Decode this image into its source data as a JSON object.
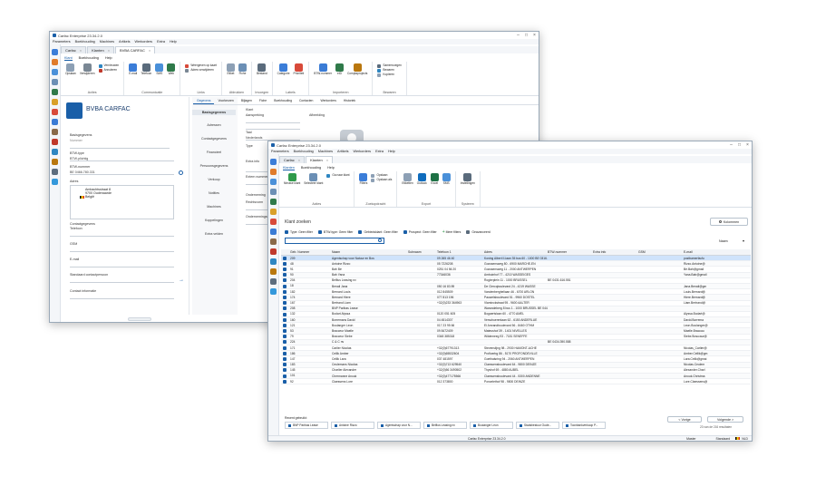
{
  "back": {
    "title": "Carfac Enterprise 23.34.2.0",
    "menu": [
      "Parameters",
      "Boekhouding",
      "Machines",
      "Artikels",
      "Werkorders",
      "Extra",
      "Help"
    ],
    "tabs": [
      {
        "label": "Carfac"
      },
      {
        "label": "Klanten"
      },
      {
        "label": "BVBA CARFAC"
      }
    ],
    "ribbon_tabs": [
      "Klant",
      "Boekhouding",
      "Help"
    ],
    "groups": {
      "acties": {
        "label": "Acties",
        "buttons": [
          "Opslaan",
          "Verwijderen"
        ],
        "small": [
          "Vernieuwen",
          "Annuleren"
        ]
      },
      "communicatie": {
        "label": "Communicatie",
        "buttons": [
          "E-mail",
          "Telefoon",
          "SMS",
          "Web"
        ]
      },
      "links": {
        "label": "Links",
        "small": [
          "Weergeven op kaart",
          "Adres verwijderen"
        ]
      },
      "afdrukken": {
        "label": "Afdrukken",
        "buttons": [
          "Etiket",
          "Fiche"
        ]
      },
      "invoegen": {
        "label": "Invoegen",
        "buttons": [
          "Bestand"
        ]
      },
      "labels": {
        "label": "Labels",
        "buttons": [
          "Categorie",
          "Prioriteit"
        ]
      },
      "importeren": {
        "label": "Importeren",
        "buttons": [
          "BTW-nummer",
          "eID",
          "Comptaprojects"
        ]
      },
      "bewaren": {
        "label": "Bewaren",
        "small": [
          "Samenvoegen",
          "Bewaren",
          "Kopieren"
        ]
      }
    },
    "customer": {
      "name": "BVBA CARFAC",
      "basisgegevens_label": "Basisgegevens",
      "nummer_label": "Nummer",
      "btw_type_label": "BTW-type",
      "btw_type": "BTW-plichtig",
      "btw_nummer_label": "BTW-nummer",
      "btw_nummer": "BE 0466.780.331",
      "adres_label": "Adres",
      "adres_lines": [
        "Ambachtsstraat 8",
        "9700 Oudenaarde",
        "België"
      ],
      "contact_label": "Contactgegevens",
      "telefoon_label": "Telefoon",
      "gsm_label": "GSM",
      "email_label": "E-mail",
      "standaard_label": "Standaard contactpersoon",
      "contact_info_label": "Contact informatie"
    },
    "nav": [
      "Basisgegevens",
      "Adressen",
      "Contactgegevens",
      "Financieel",
      "Persoonsgegevens",
      "Verkoop",
      "Notities",
      "Machines",
      "Koppelingen",
      "Extra velden"
    ],
    "subtabs": [
      "Gegevens",
      "Voorkeuren",
      "Bijlagen",
      "Fiche",
      "Boekhouding",
      "Contacten",
      "Werkorders",
      "Historiek"
    ],
    "form": {
      "klant": "Klant",
      "aanspreking": "Aanspreking",
      "afbeelding": "Afbeelding",
      "taal": "Taal",
      "taal_value": "Nederlands",
      "type": "Type",
      "extra_info": "Extra info",
      "extern_nummer": "Extern nummer",
      "onderneming": "Onderneming",
      "rechtsvorm": "Rechtsvorm",
      "ondernemingsnr": "Ondernemingsnr."
    }
  },
  "front": {
    "title": "Carfac Enterprise 23.34.2.0",
    "menu": [
      "Parameters",
      "Boekhouding",
      "Machines",
      "Artikels",
      "Werkorders",
      "Extra",
      "Help"
    ],
    "tabs": [
      {
        "label": "Carfac"
      },
      {
        "label": "Klanten"
      }
    ],
    "ribbon_tabs": [
      "Klanten",
      "Boekhouding",
      "Help"
    ],
    "groups": {
      "acties": {
        "label": "Acties",
        "buttons": [
          "Nieuwe klant",
          "Selecteer klant"
        ],
        "small": [
          "Ga naar klant"
        ]
      },
      "zoekopdracht": {
        "label": "Zoekopdracht",
        "buttons": [
          "Filters"
        ],
        "small": [
          "Opslaan",
          "Opslaan als"
        ]
      },
      "export": {
        "label": "Export",
        "buttons": [
          "Etiketten",
          "Outlook",
          "Excel",
          "SMS"
        ]
      },
      "systeem": {
        "label": "Systeem",
        "buttons": [
          "Instellingen"
        ]
      }
    },
    "search_title": "Klant zoeken",
    "kolommen_label": "Kolommen",
    "filters": [
      "Type: Geen filter",
      "BTW-type: Geen filter",
      "Gebiedsklant: Geen filter",
      "Prospect: Geen filter"
    ],
    "meer_filters": "Meer filters",
    "geavanceerd": "Geavanceerd",
    "naam_filter_label": "Naam",
    "columns": [
      "Geb. Nummer",
      "Naam",
      "Subnaam",
      "Telefoon 1",
      "Adres",
      "BTW-nummer",
      "Extra info",
      "GSM",
      "E-mail"
    ],
    "rows": [
      [
        "209",
        "Agentschap voor Natuur en Bos",
        "",
        "09 265 46 40",
        "Koning Albert II-laan 35 bus 60 - 1000 BE 0316.380.841",
        "",
        "",
        "",
        "postbamerfacfu"
      ],
      [
        "48",
        "Antoine Rizzo",
        "",
        "05 7226208",
        "Goossensweg 80 - 6900 MARCHE-EN",
        "",
        "",
        "",
        "Rizzo.Antoine@"
      ],
      [
        "91",
        "Bah Bé",
        "",
        "0251 04 56 20",
        "Goossensweg 11 - 2000 ANTWERPEN",
        "",
        "",
        "",
        "Bé.Bah@gmail"
      ],
      [
        "90",
        "Bah Yana",
        "",
        "77346036",
        "Ambuinhof 77 - 4210 WASSEIGES",
        "",
        "",
        "",
        "Yana.Bah@gmail"
      ],
      [
        "204",
        "Belfius Leasing nv",
        "",
        "",
        "Rogierplein 11 - 1000 BRUSSEL",
        "BE 0431.616.551",
        "",
        "",
        ""
      ],
      [
        "18",
        "Benali Jana",
        "",
        "050 16 83 89",
        "De Clercqboulevard 24 - 4219 WASSE",
        "",
        "",
        "",
        "Jana.Benali@gm"
      ],
      [
        "182",
        "Bernard Louis",
        "",
        "012 845509",
        "Vandenbergheliaan 46 - 6700 ARLON",
        "",
        "",
        "",
        "Louis.Bernard@"
      ],
      [
        "174",
        "Bernard Hiere",
        "",
        "077 813 196",
        "Pauwelsboulevard 51 - 9960 DOSTEL",
        "",
        "",
        "",
        "Hiere.Bernard@"
      ],
      [
        "167",
        "Bertrand Liam",
        "",
        "+32(0)233 364963",
        "Vlaminckstraat 95 - 9600 AALTER",
        "",
        "",
        "",
        "Liam.Bertrand@"
      ],
      [
        "208",
        "BNP Paribas Lease",
        "",
        "",
        "Warandeberg 8 bus 1 - 1000 BRUSSEL BE 0444.779.141",
        "",
        "",
        "",
        ""
      ],
      [
        "132",
        "Bodart Alyssa",
        "",
        "0120 051 605",
        "Bogaertslaan 60 - 4770 AMEL",
        "",
        "",
        "",
        "Alyssa.Bodart@"
      ],
      [
        "160",
        "Borremans David",
        "",
        "04 4514307",
        "Verschuerenlaan 62 - 6150 ANDERLUE",
        "",
        "",
        "",
        "David.Borrema"
      ],
      [
        "121",
        "Boulanger Leon",
        "",
        "017 23 95 66",
        "El Amrandboulevard 56 - 8460 OTHM",
        "",
        "",
        "",
        "Leon.Boulanger@"
      ],
      [
        "53",
        "Bracceur Maelle",
        "",
        "09 8472409",
        "Mateushof 39 - 1401 NIVELLES",
        "",
        "",
        "",
        "Maelle.Braccau"
      ],
      [
        "79",
        "Bracceur Siebe",
        "",
        "0348 385318",
        "Wildemeeg 93 - 7181 SENEFFE",
        "",
        "",
        "",
        "Siebe.Braccaur@"
      ],
      [
        "224",
        "C & C nv",
        "",
        "",
        "",
        "BE 0434.390.558",
        "",
        "",
        ""
      ],
      [
        "171",
        "Carlier Nicolas",
        "",
        "+32(0)67791313",
        "Stevenslijng 98 - 2930 HAMONT-ACHE",
        "",
        "",
        "",
        "Nicolas_Carlier@"
      ],
      [
        "186",
        "Cellik Amber",
        "",
        "+32(0)65532604",
        "Profloerbg 86 - 5170 PROFONDEVILLE",
        "",
        "",
        "",
        "Amber.Cellik@gm"
      ],
      [
        "147",
        "Cellik Lara",
        "",
        "037 481597",
        "Goethalsring 94 - 2060 ANTWERPEN",
        "",
        "",
        "",
        "Lara.Celik@gmai"
      ],
      [
        "183",
        "Ceulemans Nicolas",
        "",
        "+32(0)713 629540",
        "Claessensboulevard 64 - 9800 DEINZE",
        "",
        "",
        "",
        "Nicolas.Ceulem"
      ],
      [
        "145",
        "Charlier Alexander",
        "",
        "+32(0)56 3490502",
        "Thyshof 69 - 4880 AUBEL",
        "",
        "",
        "",
        "Alexander.Charl"
      ],
      [
        "101",
        "Chermanne Anouk",
        "",
        "+32(0)477175566",
        "Claessensboulevard 44 - 5300 ANDENNE",
        "",
        "",
        "",
        "Anouk.Christma"
      ],
      [
        "92",
        "Claessens Lore",
        "",
        "012 373800",
        "Poncelethof 98 - 9800 DEINZE",
        "",
        "",
        "",
        "Lore.Claessens@"
      ]
    ],
    "recent_label": "Recent gebruikt:",
    "recent": [
      "BNP Paribas Lease",
      "Antoine Rizzo",
      "Agentschap voor N...",
      "Belfius Leasing nv",
      "Boulanger Leon",
      "Stadsbestuur Oude...",
      "Toonbankverkoop P..."
    ],
    "vorige": "< Vorige",
    "volgende": "Volgende >",
    "result_count": "23 van de 216 resultaten",
    "status_center": "Carfac Enterprise 23.34.2.0",
    "status_user": "Master",
    "status_mode": "Standaard",
    "status_lang": "NLD"
  },
  "colors": {
    "accent": "#1a5fa8",
    "selected_row": "#cfe3fb"
  }
}
